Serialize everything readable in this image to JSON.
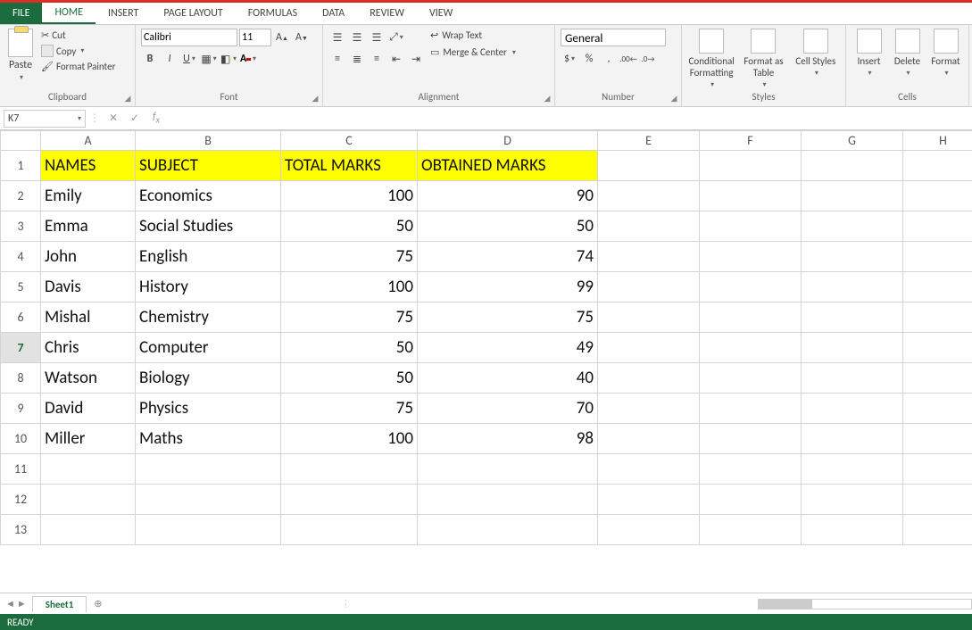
{
  "tabs": {
    "file": "FILE",
    "home": "HOME",
    "insert": "INSERT",
    "page_layout": "PAGE LAYOUT",
    "formulas": "FORMULAS",
    "data": "DATA",
    "review": "REVIEW",
    "view": "VIEW"
  },
  "clipboard": {
    "paste": "Paste",
    "cut": "Cut",
    "copy": "Copy",
    "fp": "Format Painter",
    "label": "Clipboard"
  },
  "font": {
    "name": "Calibri",
    "size": "11",
    "label": "Font"
  },
  "alignment": {
    "wrap": "Wrap Text",
    "merge": "Merge & Center",
    "label": "Alignment"
  },
  "number": {
    "format": "General",
    "label": "Number"
  },
  "styles": {
    "cond": "Conditional Formatting",
    "fas": "Format as Table",
    "cell": "Cell Styles",
    "label": "Styles"
  },
  "cells": {
    "insert": "Insert",
    "delete": "Delete",
    "format": "Format",
    "label": "Cells"
  },
  "name_box": "K7",
  "sheet": "Sheet1",
  "status": "READY",
  "columns": [
    "A",
    "B",
    "C",
    "D",
    "E",
    "F",
    "G",
    "H"
  ],
  "headers": {
    "a": "NAMES",
    "b": "SUBJECT",
    "c": "TOTAL MARKS",
    "d": "OBTAINED MARKS"
  },
  "rows": [
    {
      "n": "1"
    },
    {
      "n": "2",
      "a": "Emily",
      "b": "Economics",
      "c": "100",
      "d": "90"
    },
    {
      "n": "3",
      "a": "Emma",
      "b": "Social Studies",
      "c": "50",
      "d": "50"
    },
    {
      "n": "4",
      "a": "John",
      "b": "English",
      "c": "75",
      "d": "74"
    },
    {
      "n": "5",
      "a": "Davis",
      "b": "History",
      "c": "100",
      "d": "99"
    },
    {
      "n": "6",
      "a": "Mishal",
      "b": "Chemistry",
      "c": "75",
      "d": "75"
    },
    {
      "n": "7",
      "a": "Chris",
      "b": "Computer",
      "c": "50",
      "d": "49"
    },
    {
      "n": "8",
      "a": "Watson",
      "b": "Biology",
      "c": "50",
      "d": "40"
    },
    {
      "n": "9",
      "a": "David",
      "b": "Physics",
      "c": "75",
      "d": "70"
    },
    {
      "n": "10",
      "a": "Miller",
      "b": "Maths",
      "c": "100",
      "d": "98"
    },
    {
      "n": "11"
    },
    {
      "n": "12"
    },
    {
      "n": "13"
    }
  ]
}
